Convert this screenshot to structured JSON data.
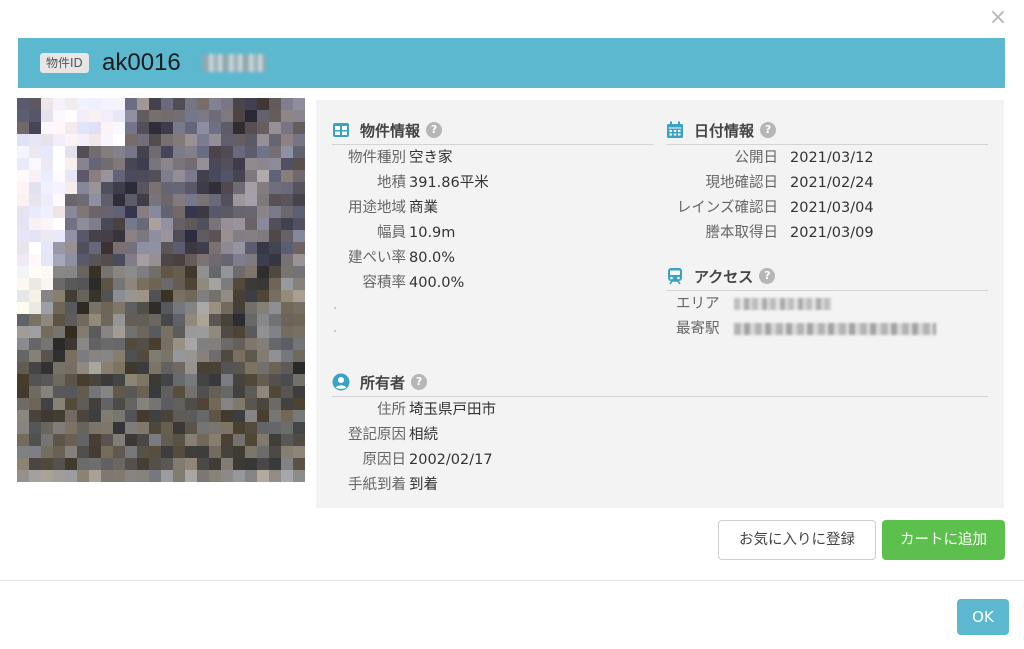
{
  "dialog": {
    "close_symbol": "×"
  },
  "header": {
    "badge": "物件ID",
    "property_id": "ak0016"
  },
  "photo": {
    "alt": "物件写真"
  },
  "property_info": {
    "title": "物件情報",
    "icon": "table-icon",
    "rows": [
      {
        "label": "物件種別",
        "value": "空き家"
      },
      {
        "label": "地積",
        "value": "391.86平米"
      },
      {
        "label": "用途地域",
        "value": "商業"
      },
      {
        "label": "幅員",
        "value": "10.9m"
      },
      {
        "label": "建ぺい率",
        "value": "80.0%"
      },
      {
        "label": "容積率",
        "value": "400.0%"
      }
    ]
  },
  "date_info": {
    "title": "日付情報",
    "icon": "calendar-icon",
    "rows": [
      {
        "label": "公開日",
        "value": "2021/03/12"
      },
      {
        "label": "現地確認日",
        "value": "2021/02/24"
      },
      {
        "label": "レインズ確認日",
        "value": "2021/03/04"
      },
      {
        "label": "謄本取得日",
        "value": "2021/03/09"
      }
    ]
  },
  "access": {
    "title": "アクセス",
    "icon": "train-icon",
    "rows": [
      {
        "label": "エリア"
      },
      {
        "label": "最寄駅"
      }
    ]
  },
  "owner": {
    "title": "所有者",
    "icon": "user-circle-icon",
    "rows": [
      {
        "label": "住所",
        "value": "埼玉県戸田市"
      },
      {
        "label": "登記原因",
        "value": "相続"
      },
      {
        "label": "原因日",
        "value": "2002/02/17"
      },
      {
        "label": "手紙到着",
        "value": "到着"
      }
    ]
  },
  "help_symbol": "?",
  "actions": {
    "favorite": "お気に入りに登録",
    "add_to_cart": "カートに追加",
    "ok": "OK"
  },
  "colors": {
    "header": "#5bb8cf",
    "accent_icon": "#3aa2c4",
    "cart": "#5cc14c",
    "ok": "#5bb8cf",
    "panel": "#f3f3f3"
  }
}
